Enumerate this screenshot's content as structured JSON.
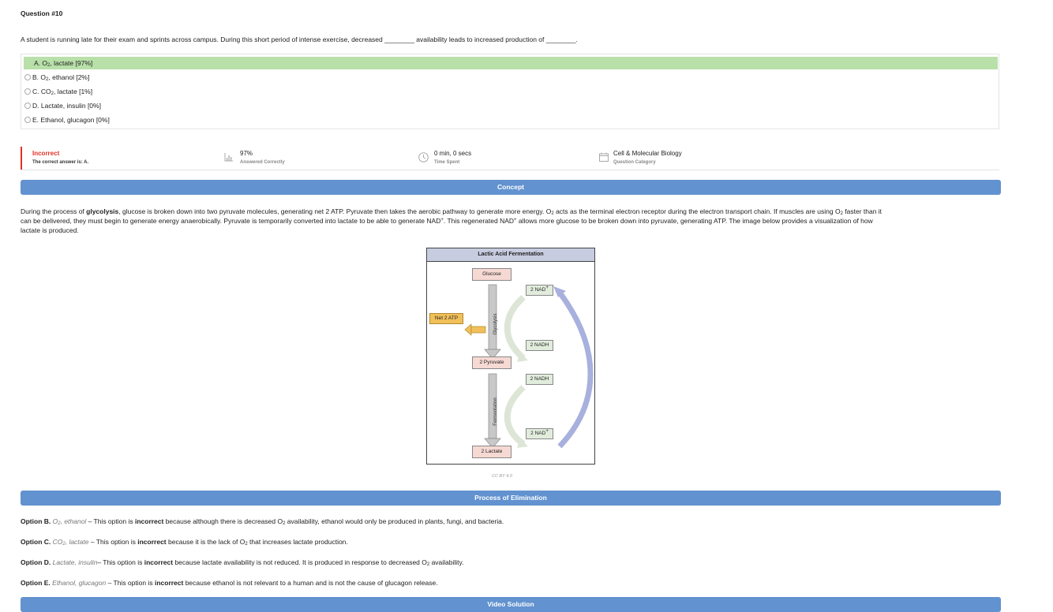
{
  "question": {
    "number": "Question #10",
    "text": "A student is running late for their exam and sprints across campus. During this short period of intense exercise, decreased ________ availability leads to increased production of ________."
  },
  "choices": [
    {
      "letter": "A.",
      "pre": "O",
      "sub": "2",
      "post": ", lactate [97%]",
      "correct": true
    },
    {
      "letter": "B.",
      "pre": "O",
      "sub": "2",
      "post": ", ethanol [2%]",
      "correct": false
    },
    {
      "letter": "C.",
      "pre": "CO",
      "sub": "2",
      "post": ", lactate [1%]",
      "correct": false
    },
    {
      "letter": "D.",
      "pre": "Lactate, insulin [0%]",
      "sub": "",
      "post": "",
      "correct": false
    },
    {
      "letter": "E.",
      "pre": "Ethanol, glucagon [0%]",
      "sub": "",
      "post": "",
      "correct": false
    }
  ],
  "stats": {
    "result": "Incorrect",
    "correct_answer": "The correct answer is: A.",
    "percent": "97%",
    "percent_label": "Answered Correctly",
    "time": "0 min, 0 secs",
    "time_label": "Time Spent",
    "category": "Cell & Molecular Biology",
    "category_label": "Question Category"
  },
  "concept": {
    "heading": "Concept",
    "p1": "During the process of ",
    "bold": "glycolysis",
    "p2": ", glucose is broken down into two pyruvate molecules, generating net 2 ATP. Pyruvate then takes the aerobic pathway to generate more energy. O",
    "p3": " acts as the terminal electron receptor during the electron transport chain. If muscles are using O",
    "p4": " faster than it",
    "p5": "can be delivered, they must begin to generate energy anaerobically. Pyruvate is temporarily converted into lactate to be able to generate NAD",
    "p6": ". This regenerated NAD",
    "p7": " allows more glucose to be broken down into pyruvate, generating ATP. The image below provides a visualization of how",
    "p8": "lactate is produced."
  },
  "diagram": {
    "title": "Lactic Acid Fermentation",
    "glucose": "Glucose",
    "pyruvate": "2 Pyruvate",
    "lactate": "2 Lactate",
    "atp": "Net 2 ATP",
    "glycolysis": "Glycolysis",
    "fermentation": "Fermentation",
    "nad_top": "2 NAD",
    "nadh_top": "2 NADH",
    "nadh_bottom": "2 NADH",
    "nad_bottom": "2 NAD",
    "credit": "CC BY 4.0"
  },
  "elimination": {
    "heading": "Process of Elimination",
    "b": {
      "label": "Option B.",
      "it": "O",
      "it2": ", ethanol",
      "t1": " – This option is ",
      "strong": "incorrect",
      "t2": " because although there is decreased O",
      "t3": " availability, ethanol would only be produced in plants, fungi, and bacteria."
    },
    "c": {
      "label": "Option C.",
      "it": "CO",
      "it2": ", lactate",
      "t1": " – This option is ",
      "strong": "incorrect",
      "t2": " because it is the lack of O",
      "t3": " that increases lactate production."
    },
    "d": {
      "label": "Option D.",
      "it": "Lactate, insulin",
      "t1": "– This option is ",
      "strong": "incorrect",
      "t2": " because lactate availability is not reduced. It is produced in response to decreased O",
      "t3": " availability."
    },
    "e": {
      "label": "Option E.",
      "it": "Ethanol, glucagon",
      "t1": " – This option is ",
      "strong": "incorrect",
      "t2": " because ethanol is not relevant to a human and is not the cause of glucagon release."
    }
  },
  "next_banner": {
    "heading": "Video Solution"
  },
  "colors": {
    "banner": "#6292cf",
    "correct_bg": "#b8e0a8",
    "incorrect": "#e03127"
  }
}
